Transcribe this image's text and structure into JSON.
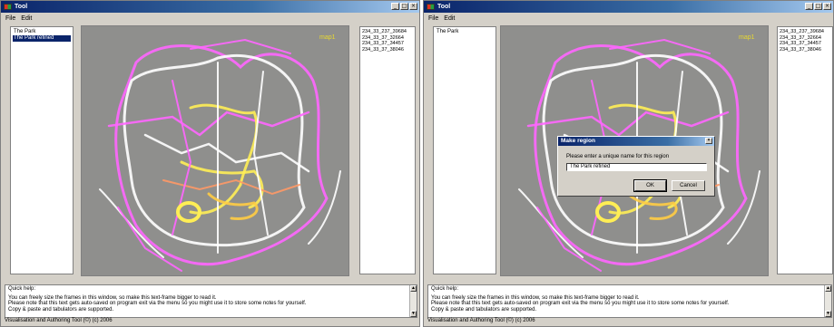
{
  "app": {
    "title": "Tool",
    "window_buttons": {
      "minimize": "_",
      "maximize": "□",
      "close": "×"
    }
  },
  "menu": [
    "File",
    "Edit"
  ],
  "left_window": {
    "regions": [
      {
        "label": "The Park",
        "selected": false
      },
      {
        "label": "The Park refined",
        "selected": true
      }
    ]
  },
  "right_window": {
    "regions": [
      {
        "label": "The Park",
        "selected": false
      }
    ]
  },
  "files": [
    "234_33_237_39684",
    "234_33_37_32664",
    "234_33_37_34457",
    "234_33_37_38046"
  ],
  "map": {
    "label": "map1",
    "label_color": "#e8d830",
    "background": "#8f8f8d"
  },
  "help": {
    "title": "Quick help:",
    "lines": [
      "You can freely size the frames in this window, so make this text-frame bigger to read it.",
      "Please note that this text gets auto-saved on program exit via the menu so you might use it to store some notes for yourself.",
      "Copy & paste and tabulators are supported."
    ]
  },
  "status": "Visualisation and Authoring Tool (©) (c) 2006",
  "dialog": {
    "title": "Make region",
    "close": "×",
    "prompt": "Please enter a unique name for this region",
    "value": "The Park refined",
    "ok": "OK",
    "cancel": "Cancel"
  }
}
